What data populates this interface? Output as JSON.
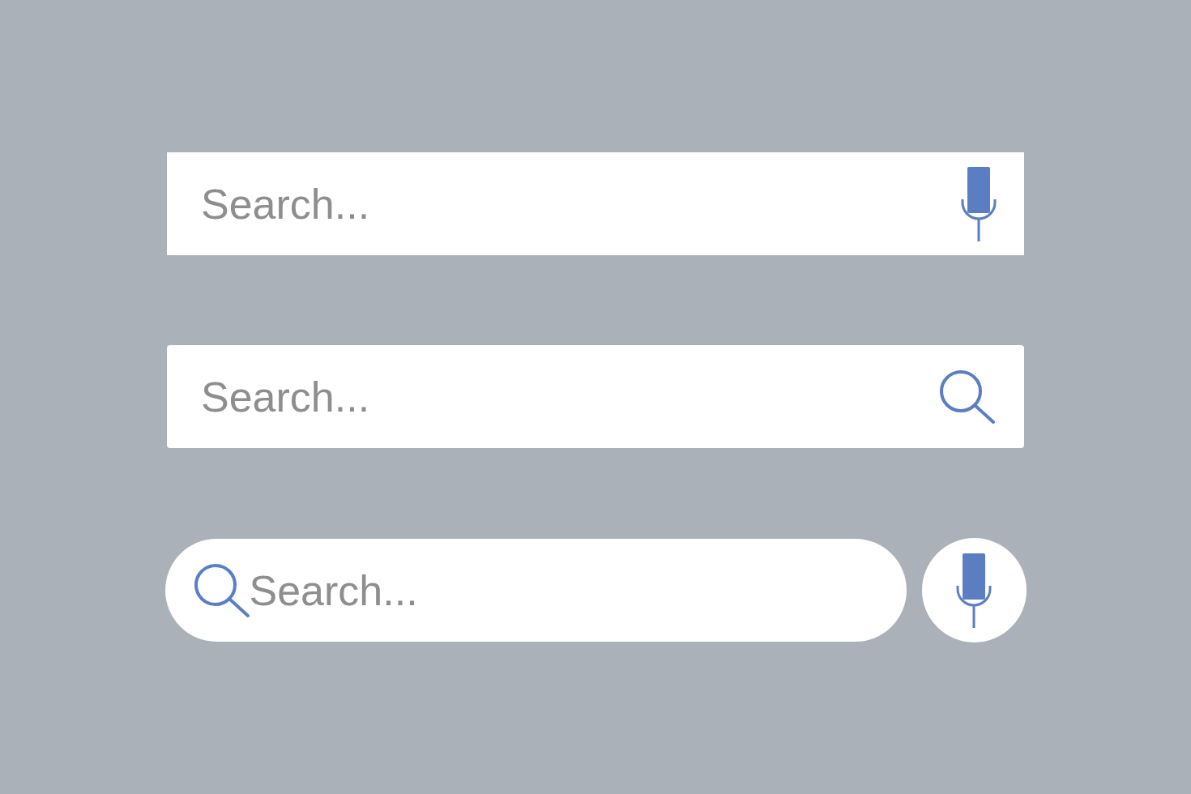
{
  "search_bars": [
    {
      "kind": "square_with_mic",
      "placeholder": "Search..."
    },
    {
      "kind": "rounded_with_search",
      "placeholder": "Search..."
    },
    {
      "kind": "pill_with_mic_button",
      "placeholder": "Search..."
    }
  ]
}
